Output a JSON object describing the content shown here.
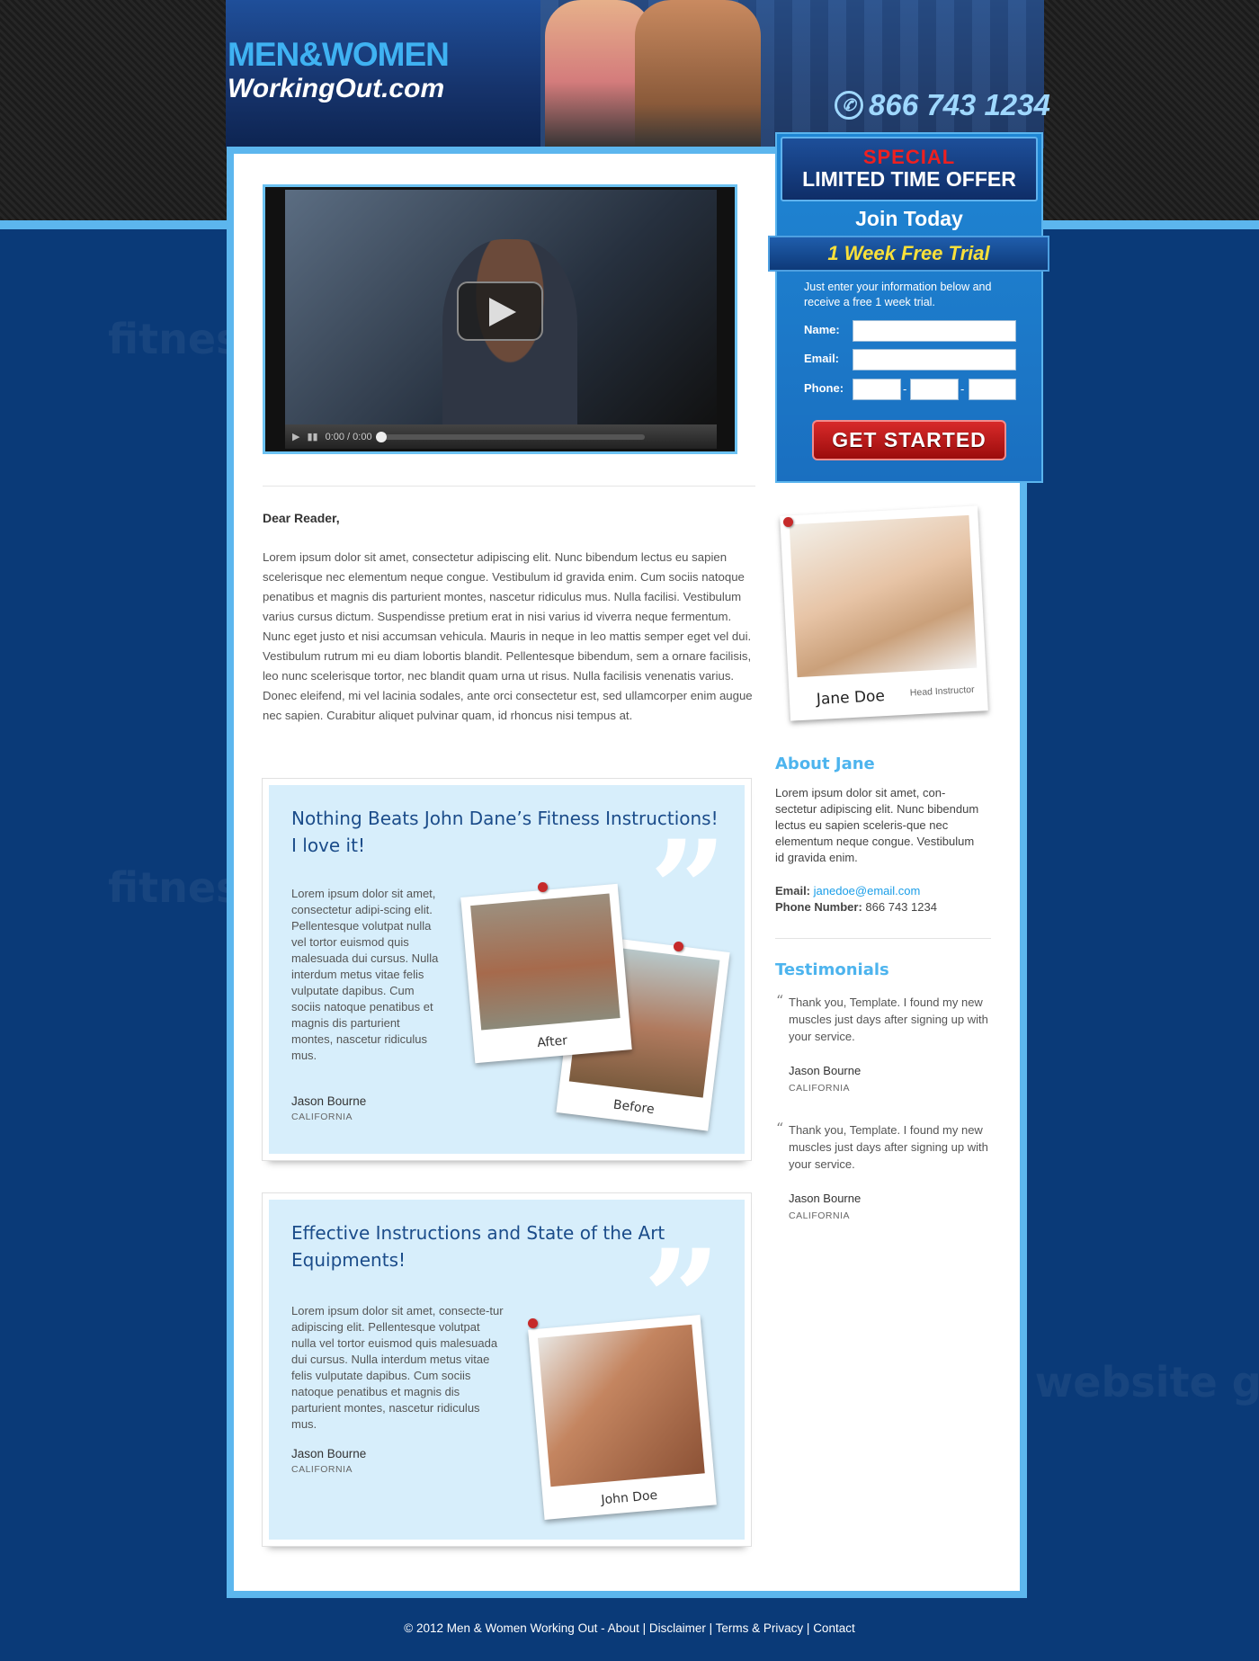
{
  "header": {
    "logo_line1": "MEN&WOMEN",
    "logo_line2": "WorkingOut.com",
    "phone": "866 743 1234",
    "watermark": "fitness website gurus"
  },
  "video": {
    "time": "0:00 / 0:00"
  },
  "letter": {
    "salutation": "Dear Reader,",
    "body": "Lorem ipsum dolor sit amet, consectetur adipiscing elit. Nunc bibendum lectus eu sapien scelerisque nec elementum neque congue. Vestibulum id gravida enim. Cum sociis natoque penatibus et magnis dis parturient montes, nascetur ridiculus mus. Nulla facilisi. Vestibulum varius cursus dictum. Suspendisse pretium erat in nisi varius id viverra neque fermentum. Nunc eget justo et nisi accumsan vehicula. Mauris in neque in leo mattis semper eget vel dui. Vestibulum rutrum mi eu diam lobortis blandit. Pellentesque bibendum, sem a ornare facilisis, leo nunc scelerisque tortor, nec blandit quam urna ut risus. Nulla facilisis venenatis varius. Donec eleifend, mi vel lacinia sodales, ante orci consectetur est, sed ullamcorper enim augue nec sapien. Curabitur aliquet pulvinar quam, id rhoncus nisi tempus at."
  },
  "testimonial1": {
    "title": "Nothing Beats John Dane’s Fitness Instructions! I love it!",
    "body": "Lorem ipsum dolor sit amet, consectetur adipi-scing elit. Pellentesque volutpat nulla vel tortor euismod quis malesuada dui cursus. Nulla interdum metus vitae felis vulputate dapibus. Cum sociis natoque penatibus et magnis dis parturient montes, nascetur ridiculus mus.",
    "name": "Jason Bourne",
    "location": "CALIFORNIA",
    "after_caption": "After",
    "before_caption": "Before"
  },
  "testimonial2": {
    "title": "Effective Instructions and State of the Art Equipments!",
    "body": "Lorem ipsum dolor sit amet, consecte-tur adipiscing elit. Pellentesque volutpat nulla vel tortor euismod quis malesuada dui cursus. Nulla interdum metus vitae felis vulputate dapibus. Cum sociis natoque penatibus et magnis dis parturient montes, nascetur ridiculus mus.",
    "name": "Jason Bourne",
    "location": "CALIFORNIA",
    "photo_caption": "John Doe"
  },
  "offer": {
    "special": "SPECIAL",
    "headline": "LIMITED TIME OFFER",
    "join": "Join Today",
    "trial": "1 Week Free Trial",
    "intro": "Just enter your information below and receive a free 1 week trial.",
    "name_label": "Name:",
    "email_label": "Email:",
    "phone_label": "Phone:",
    "phone_sep": "-",
    "button": "GET STARTED"
  },
  "instructor": {
    "name": "Jane Doe",
    "role": "Head Instructor"
  },
  "about": {
    "heading": "About Jane",
    "text": "Lorem ipsum dolor sit amet, con-sectetur adipiscing elit. Nunc bibendum lectus eu sapien sceleris-que nec elementum neque congue. Vestibulum id gravida enim.",
    "email_label": "Email:",
    "email": "janedoe@email.com",
    "phone_label": "Phone Number:",
    "phone": "866 743 1234"
  },
  "testimonials": {
    "heading": "Testimonials",
    "items": [
      {
        "quote": "Thank you, Template. I found my new muscles just days after signing up with your service.",
        "name": "Jason Bourne",
        "location": "CALIFORNIA"
      },
      {
        "quote": "Thank you, Template. I found my new muscles just days after signing up with your service.",
        "name": "Jason Bourne",
        "location": "CALIFORNIA"
      }
    ]
  },
  "footer": {
    "copyright": "© 2012 Men & Women Working Out - ",
    "links": [
      "About",
      "Disclaimer",
      "Terms & Privacy",
      "Contact"
    ],
    "sep": " | "
  },
  "colors": {
    "page_bg": "#0a3a78",
    "accent": "#5cb6ee",
    "heading_blue": "#1b4c8a",
    "cta_red": "#c41a1a",
    "trial_yellow": "#f9e03a"
  }
}
